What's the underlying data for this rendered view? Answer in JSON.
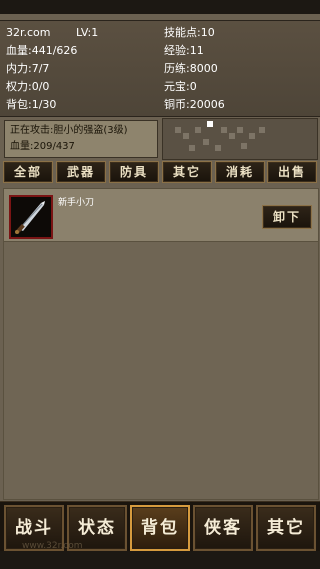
{
  "stats": {
    "site": "32r.com",
    "level": "LV:1",
    "skill_points": "技能点:10",
    "hp": "血量:441/626",
    "exp": "经验:11",
    "stamina": "内力:7/7",
    "training": "历练:8000",
    "power": "权力:0/0",
    "ingot": "元宝:0",
    "bag": "背包:1/30",
    "copper": "铜币:20006"
  },
  "battle": {
    "attacking": "正在攻击:胆小的强盗(3级)",
    "enemy_hp": "血量:209/437"
  },
  "tabs": [
    "全部",
    "武器",
    "防具",
    "其它",
    "消耗",
    "出售"
  ],
  "inventory": {
    "items": [
      {
        "name": "新手小刀",
        "icon": "dagger-icon",
        "action": "卸下"
      }
    ]
  },
  "nav": [
    "战斗",
    "状态",
    "背包",
    "侠客",
    "其它"
  ],
  "nav_active": "背包",
  "watermark": "www.32r.com",
  "colors": {
    "accent": "#d69b3e",
    "panel": "#8b816c",
    "item_border": "#7a1414"
  }
}
